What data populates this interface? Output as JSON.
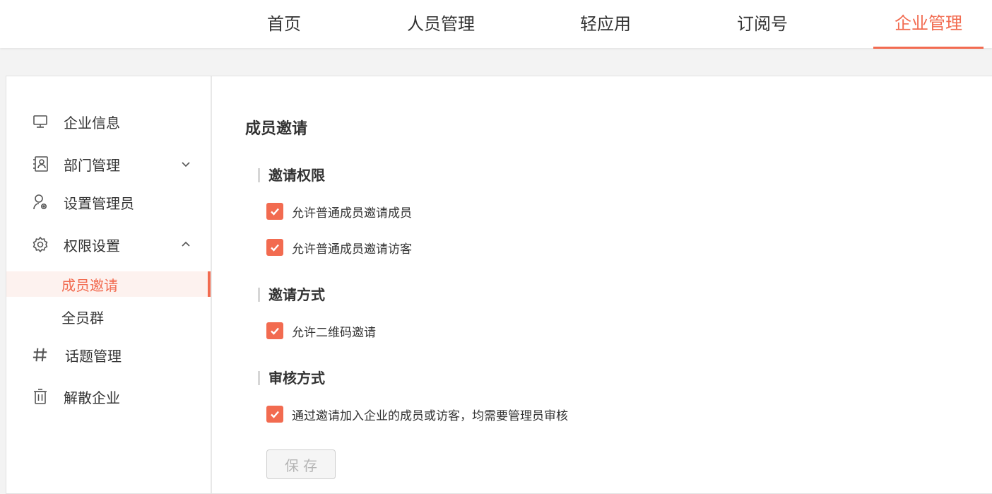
{
  "topnav": {
    "items": [
      {
        "label": "首页",
        "active": false
      },
      {
        "label": "人员管理",
        "active": false
      },
      {
        "label": "轻应用",
        "active": false
      },
      {
        "label": "订阅号",
        "active": false
      },
      {
        "label": "企业管理",
        "active": true
      }
    ]
  },
  "sidebar": {
    "items": [
      {
        "label": "企业信息",
        "icon": "monitor-icon"
      },
      {
        "label": "部门管理",
        "icon": "contact-card-icon",
        "chevron": "chevron-down-icon"
      },
      {
        "label": "设置管理员",
        "icon": "admin-user-icon"
      },
      {
        "label": "权限设置",
        "icon": "gear-icon",
        "chevron": "chevron-up-icon"
      },
      {
        "label": "话题管理",
        "icon": "hash-icon"
      },
      {
        "label": "解散企业",
        "icon": "trash-icon"
      }
    ],
    "subitems": [
      {
        "label": "成员邀请",
        "active": true
      },
      {
        "label": "全员群",
        "active": false
      }
    ]
  },
  "content": {
    "title": "成员邀请",
    "sections": [
      {
        "title": "邀请权限",
        "options": [
          "允许普通成员邀请成员",
          "允许普通成员邀请访客"
        ]
      },
      {
        "title": "邀请方式",
        "options": [
          "允许二维码邀请"
        ]
      },
      {
        "title": "审核方式",
        "options": [
          "通过邀请加入企业的成员或访客，均需要管理员审核"
        ]
      }
    ],
    "save_label": "保存"
  },
  "colors": {
    "accent": "#f26b50",
    "active_bg": "#fdf2ef"
  }
}
